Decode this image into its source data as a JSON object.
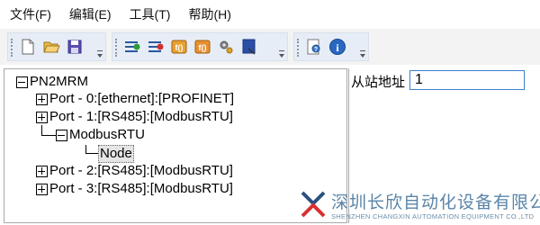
{
  "menu": [
    {
      "label": "文件(F)"
    },
    {
      "label": "编辑(E)"
    },
    {
      "label": "工具(T)"
    },
    {
      "label": "帮助(H)"
    }
  ],
  "toolbar": {
    "group1": [
      "new-file-icon",
      "open-folder-icon",
      "save-icon"
    ],
    "group2": [
      "list-add-icon",
      "list-remove-icon",
      "function-icon",
      "function-alt-icon",
      "gear-icon",
      "download-icon"
    ],
    "group3": [
      "help-search-icon",
      "info-icon"
    ]
  },
  "tree": {
    "root": "PN2MRM",
    "port0": "Port - 0:[ethernet]:[PROFINET]",
    "port1": "Port - 1:[RS485]:[ModbusRTU]",
    "modbus": "ModbusRTU",
    "node": "Node",
    "port2": "Port - 2:[RS485]:[ModbusRTU]",
    "port3": "Port - 3:[RS485]:[ModbusRTU]"
  },
  "panel": {
    "slave_address_label": "从站地址",
    "slave_address_value": "1"
  },
  "watermark": {
    "cn": "深圳长欣自动化设备有限公司",
    "en": "SHENZHEN CHANGXIN AUTOMATION EQUIPMENT CO.,LTD"
  },
  "colors": {
    "toolbar_bg": "#e6edf6",
    "input_border": "#3d7fd0",
    "watermark": "#5a84a8"
  }
}
